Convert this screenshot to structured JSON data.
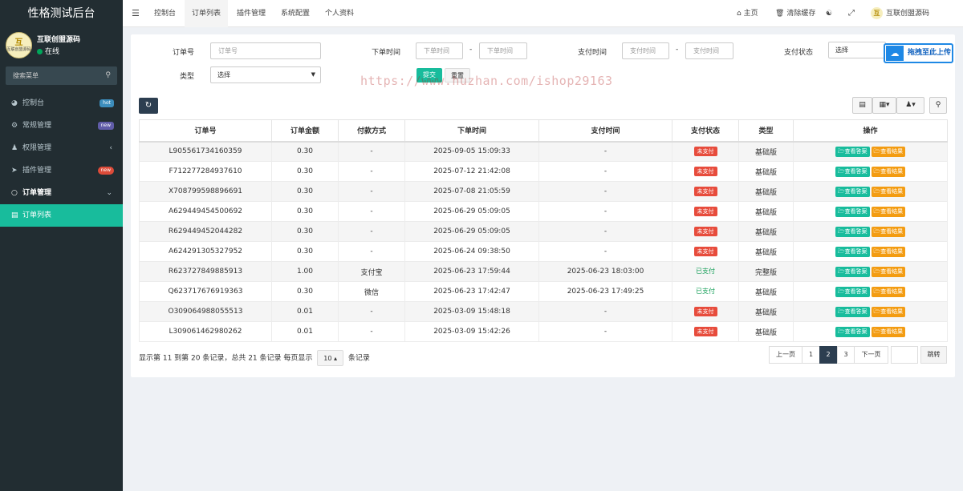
{
  "app": {
    "title": "性格测试后台"
  },
  "user": {
    "avatar_text": "互",
    "avatar_sub": "互联创盟源码",
    "name": "互联创盟源码",
    "status": "在线"
  },
  "sidebar": {
    "search_placeholder": "搜索菜单",
    "items": [
      {
        "label": "控制台",
        "icon": "dashboard-icon",
        "badge": "hot",
        "badge_color": "#3c8dbc"
      },
      {
        "label": "常规管理",
        "icon": "cogs-icon",
        "badge": "new",
        "badge_color": "#605ca8"
      },
      {
        "label": "权限管理",
        "icon": "users-icon",
        "arrow": "‹"
      },
      {
        "label": "插件管理",
        "icon": "rocket-icon",
        "badge": "new",
        "badge_color": "#dd4b39"
      },
      {
        "label": "订单管理",
        "icon": "circle-icon",
        "arrow": "⌄"
      },
      {
        "label": "订单列表",
        "icon": "list-icon"
      }
    ]
  },
  "topnav": {
    "tabs": [
      "控制台",
      "订单列表",
      "插件管理",
      "系统配置",
      "个人资料"
    ],
    "right": {
      "home": "主页",
      "clear_cache": "清除缓存",
      "user": "互联创盟源码"
    }
  },
  "filters": {
    "order_no_label": "订单号",
    "order_no_placeholder": "订单号",
    "order_time_label": "下单时间",
    "order_time_placeholder": "下单时间",
    "pay_time_label": "支付时间",
    "pay_time_placeholder": "支付时间",
    "range_sep": "-",
    "pay_status_label": "支付状态",
    "pay_status_value": "选择",
    "type_label": "类型",
    "type_value": "选择",
    "submit": "提交",
    "reset": "重置"
  },
  "watermark": "https://www.huzhan.com/ishop29163",
  "upload_widget": "拖拽至此上传",
  "table": {
    "headers": [
      "订单号",
      "订单金额",
      "付款方式",
      "下单时间",
      "支付时间",
      "支付状态",
      "类型",
      "操作"
    ],
    "action_labels": [
      "查看答案",
      "查看结果"
    ],
    "rows": [
      {
        "order_no": "L905561734160359",
        "amount": "0.30",
        "method": "-",
        "order_time": "2025-09-05 15:09:33",
        "pay_time": "-",
        "status": "未支付",
        "paid": false,
        "type": "基础版"
      },
      {
        "order_no": "F712277284937610",
        "amount": "0.30",
        "method": "-",
        "order_time": "2025-07-12 21:42:08",
        "pay_time": "-",
        "status": "未支付",
        "paid": false,
        "type": "基础版"
      },
      {
        "order_no": "X708799598896691",
        "amount": "0.30",
        "method": "-",
        "order_time": "2025-07-08 21:05:59",
        "pay_time": "-",
        "status": "未支付",
        "paid": false,
        "type": "基础版"
      },
      {
        "order_no": "A629449454500692",
        "amount": "0.30",
        "method": "-",
        "order_time": "2025-06-29 05:09:05",
        "pay_time": "-",
        "status": "未支付",
        "paid": false,
        "type": "基础版"
      },
      {
        "order_no": "R629449452044282",
        "amount": "0.30",
        "method": "-",
        "order_time": "2025-06-29 05:09:05",
        "pay_time": "-",
        "status": "未支付",
        "paid": false,
        "type": "基础版"
      },
      {
        "order_no": "A624291305327952",
        "amount": "0.30",
        "method": "-",
        "order_time": "2025-06-24 09:38:50",
        "pay_time": "-",
        "status": "未支付",
        "paid": false,
        "type": "基础版"
      },
      {
        "order_no": "R623727849885913",
        "amount": "1.00",
        "method": "支付宝",
        "order_time": "2025-06-23 17:59:44",
        "pay_time": "2025-06-23 18:03:00",
        "status": "已支付",
        "paid": true,
        "type": "完整版"
      },
      {
        "order_no": "Q623717676919363",
        "amount": "0.30",
        "method": "微信",
        "order_time": "2025-06-23 17:42:47",
        "pay_time": "2025-06-23 17:49:25",
        "status": "已支付",
        "paid": true,
        "type": "基础版"
      },
      {
        "order_no": "O309064988055513",
        "amount": "0.01",
        "method": "-",
        "order_time": "2025-03-09 15:48:18",
        "pay_time": "-",
        "status": "未支付",
        "paid": false,
        "type": "基础版"
      },
      {
        "order_no": "L309061462980262",
        "amount": "0.01",
        "method": "-",
        "order_time": "2025-03-09 15:42:26",
        "pay_time": "-",
        "status": "未支付",
        "paid": false,
        "type": "基础版"
      }
    ]
  },
  "pagination": {
    "info_before": "显示第 11 到第 20 条记录，总共 21 条记录 每页显示",
    "page_size": "10",
    "info_after": "条记录",
    "prev": "上一页",
    "pages": [
      "1",
      "2",
      "3"
    ],
    "current": "2",
    "next": "下一页",
    "jump_value": "",
    "jump": "跳转"
  },
  "colors": {
    "accent": "#18bc9c",
    "sidebar": "#222d32",
    "unpaid": "#e74c3c",
    "paid": "#18a05a",
    "view": "#f39c12"
  }
}
